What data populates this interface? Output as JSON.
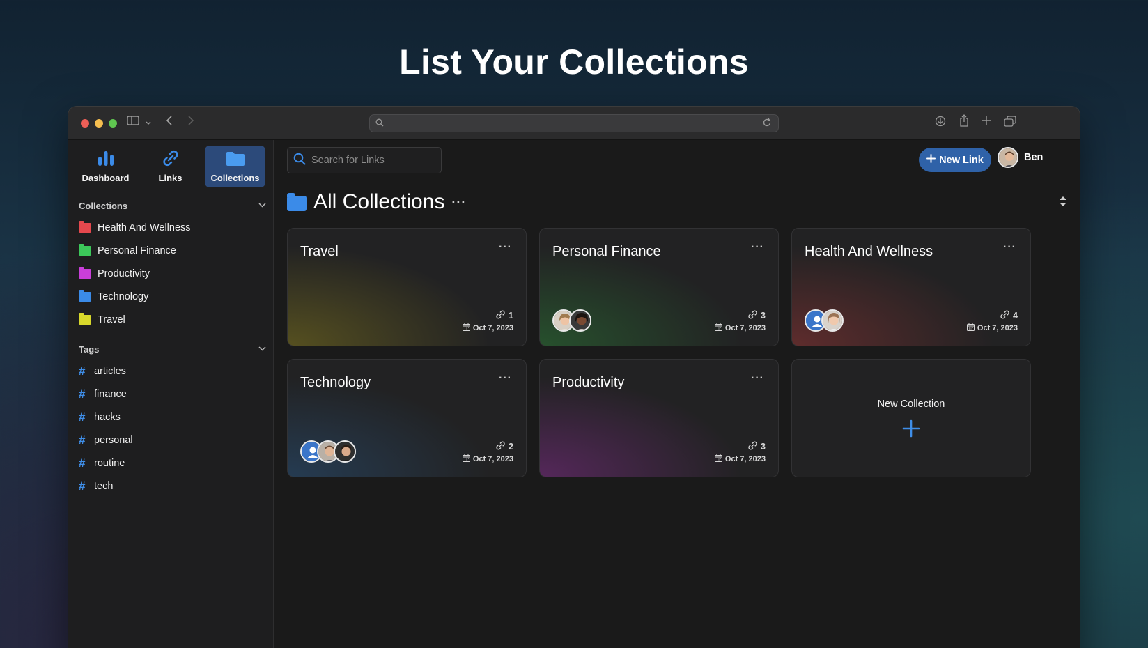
{
  "headline": "List Your Collections",
  "nav": {
    "tabs": [
      {
        "label": "Dashboard",
        "icon": "bar-chart-icon"
      },
      {
        "label": "Links",
        "icon": "link-icon"
      },
      {
        "label": "Collections",
        "icon": "folder-icon",
        "active": true
      }
    ]
  },
  "sidebar": {
    "collections_heading": "Collections",
    "collections": [
      {
        "label": "Health And Wellness",
        "color": "#e5484d"
      },
      {
        "label": "Personal Finance",
        "color": "#3cc85a"
      },
      {
        "label": "Productivity",
        "color": "#c93ed9"
      },
      {
        "label": "Technology",
        "color": "#3b8be8"
      },
      {
        "label": "Travel",
        "color": "#d8d82b"
      }
    ],
    "tags_heading": "Tags",
    "tags": [
      "articles",
      "finance",
      "hacks",
      "personal",
      "routine",
      "tech"
    ]
  },
  "topbar": {
    "search_placeholder": "Search for Links",
    "new_link_label": "New Link",
    "user_name": "Ben"
  },
  "page": {
    "title": "All Collections",
    "cards": [
      {
        "title": "Travel",
        "count": "1",
        "date": "Oct 7, 2023",
        "members": 0,
        "tint": "#b6a51a"
      },
      {
        "title": "Personal Finance",
        "count": "3",
        "date": "Oct 7, 2023",
        "members": 2,
        "tint": "#2f9c3e"
      },
      {
        "title": "Health And Wellness",
        "count": "4",
        "date": "Oct 7, 2023",
        "members": 2,
        "tint": "#b33a3a"
      },
      {
        "title": "Technology",
        "count": "2",
        "date": "Oct 7, 2023",
        "members": 3,
        "tint": "#2a5f93"
      },
      {
        "title": "Productivity",
        "count": "3",
        "date": "Oct 7, 2023",
        "members": 0,
        "tint": "#9b2fa6"
      }
    ],
    "new_collection_label": "New Collection"
  }
}
